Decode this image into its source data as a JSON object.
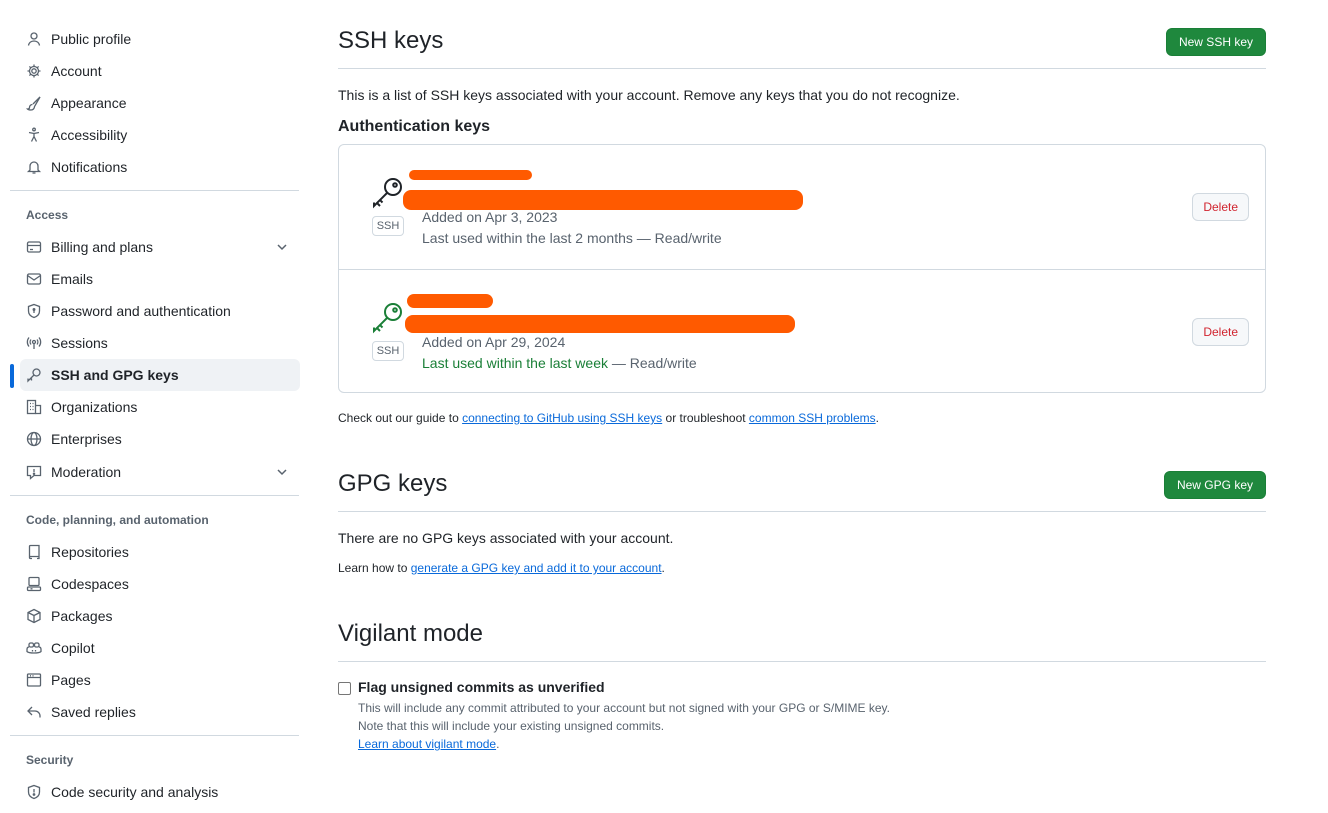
{
  "sidebar": {
    "items_top": [
      {
        "label": "Public profile",
        "icon": "person-icon"
      },
      {
        "label": "Account",
        "icon": "gear-icon"
      },
      {
        "label": "Appearance",
        "icon": "paintbrush-icon"
      },
      {
        "label": "Accessibility",
        "icon": "accessibility-icon"
      },
      {
        "label": "Notifications",
        "icon": "bell-icon"
      }
    ],
    "group_access": "Access",
    "items_access": [
      {
        "label": "Billing and plans",
        "icon": "credit-card-icon"
      },
      {
        "label": "Emails",
        "icon": "mail-icon"
      },
      {
        "label": "Password and authentication",
        "icon": "shield-lock-icon"
      },
      {
        "label": "Sessions",
        "icon": "broadcast-icon"
      },
      {
        "label": "SSH and GPG keys",
        "icon": "key-icon"
      },
      {
        "label": "Organizations",
        "icon": "organization-icon"
      },
      {
        "label": "Enterprises",
        "icon": "globe-icon"
      },
      {
        "label": "Moderation",
        "icon": "report-icon"
      }
    ],
    "group_code": "Code, planning, and automation",
    "items_code": [
      {
        "label": "Repositories",
        "icon": "repo-icon"
      },
      {
        "label": "Codespaces",
        "icon": "codespaces-icon"
      },
      {
        "label": "Packages",
        "icon": "package-icon"
      },
      {
        "label": "Copilot",
        "icon": "copilot-icon"
      },
      {
        "label": "Pages",
        "icon": "browser-icon"
      },
      {
        "label": "Saved replies",
        "icon": "reply-icon"
      }
    ],
    "group_security": "Security",
    "items_security": [
      {
        "label": "Code security and analysis",
        "icon": "shield-icon"
      }
    ]
  },
  "ssh": {
    "title": "SSH keys",
    "new_button": "New SSH key",
    "description": "This is a list of SSH keys associated with your account. Remove any keys that you do not recognize.",
    "auth_heading": "Authentication keys",
    "keys": [
      {
        "badge": "SSH",
        "added": "Added on Apr 3, 2023",
        "last_used": "Last used within the last 2 months",
        "access": " — Read/write",
        "delete_label": "Delete",
        "recent": false
      },
      {
        "badge": "SSH",
        "added": "Added on Apr 29, 2024",
        "last_used": "Last used within the last week",
        "access": " — Read/write",
        "delete_label": "Delete",
        "recent": true
      }
    ],
    "guide_prefix": "Check out our guide to ",
    "guide_link1": "connecting to GitHub using SSH keys",
    "guide_mid": " or troubleshoot ",
    "guide_link2": "common SSH problems",
    "guide_suffix": "."
  },
  "gpg": {
    "title": "GPG keys",
    "new_button": "New GPG key",
    "empty": "There are no GPG keys associated with your account.",
    "learn_prefix": "Learn how to ",
    "learn_link": "generate a GPG key and add it to your account",
    "learn_suffix": "."
  },
  "vigilant": {
    "title": "Vigilant mode",
    "checkbox_label": "Flag unsigned commits as unverified",
    "checked": false,
    "note1": "This will include any commit attributed to your account but not signed with your GPG or S/MIME key.",
    "note2": "Note that this will include your existing unsigned commits.",
    "learn_link": "Learn about vigilant mode",
    "learn_suffix": "."
  },
  "colors": {
    "accent": "#0969da",
    "primary_button": "#1f883d",
    "danger": "#d1242f",
    "success_text": "#1a7f37",
    "redaction": "#ff5a00"
  }
}
